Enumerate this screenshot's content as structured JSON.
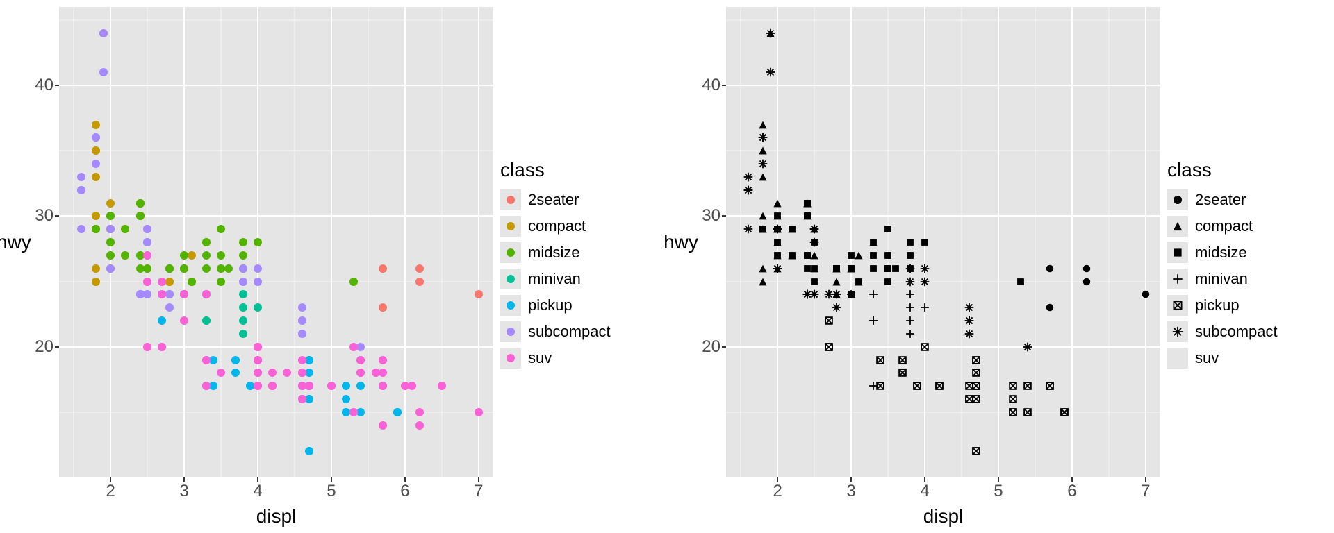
{
  "chart_data": [
    {
      "type": "scatter",
      "encoding": "color",
      "xlabel": "displ",
      "ylabel": "hwy",
      "xlim": [
        1.3,
        7.2
      ],
      "ylim": [
        10,
        46
      ],
      "x_ticks": [
        2,
        3,
        4,
        5,
        6,
        7
      ],
      "y_ticks": [
        20,
        30,
        40
      ],
      "legend_title": "class",
      "classes": [
        "2seater",
        "compact",
        "midsize",
        "minivan",
        "pickup",
        "subcompact",
        "suv"
      ],
      "colors": {
        "2seater": "#F8766D",
        "compact": "#C49A00",
        "midsize": "#53B400",
        "minivan": "#00C094",
        "pickup": "#00B6EB",
        "subcompact": "#A58AFF",
        "suv": "#FB61D7"
      },
      "series": [
        {
          "name": "2seater",
          "points": [
            [
              5.7,
              26
            ],
            [
              5.7,
              23
            ],
            [
              6.2,
              26
            ],
            [
              6.2,
              25
            ],
            [
              7.0,
              24
            ]
          ]
        },
        {
          "name": "compact",
          "points": [
            [
              1.8,
              29
            ],
            [
              1.8,
              29
            ],
            [
              2.0,
              31
            ],
            [
              2.0,
              30
            ],
            [
              2.8,
              26
            ],
            [
              2.8,
              26
            ],
            [
              3.1,
              27
            ],
            [
              1.8,
              26
            ],
            [
              1.8,
              25
            ],
            [
              2.0,
              28
            ],
            [
              2.0,
              27
            ],
            [
              2.8,
              25
            ],
            [
              2.8,
              25
            ],
            [
              3.1,
              25
            ],
            [
              3.1,
              25
            ],
            [
              2.4,
              31
            ],
            [
              2.4,
              31
            ],
            [
              2.5,
              26
            ],
            [
              2.5,
              27
            ],
            [
              2.2,
              29
            ],
            [
              2.2,
              27
            ],
            [
              2.4,
              31
            ],
            [
              2.4,
              31
            ],
            [
              3.0,
              26
            ],
            [
              2.2,
              27
            ],
            [
              2.2,
              29
            ],
            [
              2.4,
              31
            ],
            [
              2.4,
              30
            ],
            [
              3.0,
              26
            ],
            [
              3.3,
              28
            ],
            [
              1.8,
              30
            ],
            [
              1.8,
              33
            ],
            [
              1.8,
              35
            ],
            [
              1.8,
              37
            ],
            [
              1.8,
              35
            ],
            [
              2.0,
              29
            ],
            [
              2.0,
              26
            ],
            [
              2.0,
              29
            ],
            [
              2.0,
              29
            ],
            [
              2.8,
              24
            ],
            [
              1.9,
              44
            ],
            [
              2.0,
              29
            ],
            [
              2.0,
              29
            ],
            [
              2.5,
              29
            ],
            [
              2.5,
              29
            ],
            [
              1.8,
              29
            ],
            [
              1.8,
              29
            ]
          ]
        },
        {
          "name": "midsize",
          "points": [
            [
              2.8,
              26
            ],
            [
              3.1,
              25
            ],
            [
              2.4,
              27
            ],
            [
              3.5,
              29
            ],
            [
              3.6,
              26
            ],
            [
              2.4,
              26
            ],
            [
              2.4,
              27
            ],
            [
              3.3,
              26
            ],
            [
              2.5,
              25
            ],
            [
              3.5,
              25
            ],
            [
              3.0,
              24
            ],
            [
              3.0,
              24
            ],
            [
              3.5,
              27
            ],
            [
              3.3,
              27
            ],
            [
              4.0,
              28
            ],
            [
              3.8,
              28
            ],
            [
              3.8,
              27
            ],
            [
              3.8,
              26
            ],
            [
              5.3,
              25
            ],
            [
              2.2,
              27
            ],
            [
              2.2,
              29
            ],
            [
              2.4,
              31
            ],
            [
              2.4,
              31
            ],
            [
              3.0,
              26
            ],
            [
              2.4,
              30
            ],
            [
              2.4,
              30
            ],
            [
              2.5,
              26
            ],
            [
              2.5,
              28
            ],
            [
              3.5,
              26
            ],
            [
              3.5,
              26
            ],
            [
              3.0,
              26
            ],
            [
              3.0,
              27
            ],
            [
              3.3,
              28
            ],
            [
              1.8,
              29
            ],
            [
              2.0,
              27
            ],
            [
              2.0,
              30
            ],
            [
              2.8,
              26
            ],
            [
              2.8,
              26
            ],
            [
              1.8,
              29
            ],
            [
              1.8,
              29
            ],
            [
              2.0,
              28
            ],
            [
              2.0,
              29
            ]
          ]
        },
        {
          "name": "minivan",
          "points": [
            [
              2.4,
              24
            ],
            [
              3.0,
              24
            ],
            [
              3.3,
              22
            ],
            [
              3.3,
              22
            ],
            [
              3.3,
              24
            ],
            [
              3.8,
              24
            ],
            [
              3.8,
              22
            ],
            [
              3.8,
              21
            ],
            [
              3.8,
              23
            ],
            [
              4.0,
              23
            ],
            [
              3.3,
              17
            ]
          ]
        },
        {
          "name": "pickup",
          "points": [
            [
              3.7,
              19
            ],
            [
              3.7,
              18
            ],
            [
              3.9,
              17
            ],
            [
              3.9,
              17
            ],
            [
              4.7,
              19
            ],
            [
              4.7,
              19
            ],
            [
              4.7,
              12
            ],
            [
              5.2,
              17
            ],
            [
              5.2,
              15
            ],
            [
              5.7,
              17
            ],
            [
              5.9,
              15
            ],
            [
              4.7,
              16
            ],
            [
              4.7,
              12
            ],
            [
              4.7,
              17
            ],
            [
              4.7,
              17
            ],
            [
              4.7,
              16
            ],
            [
              4.7,
              18
            ],
            [
              5.2,
              15
            ],
            [
              5.2,
              16
            ],
            [
              5.7,
              17
            ],
            [
              5.9,
              15
            ],
            [
              4.2,
              17
            ],
            [
              4.2,
              17
            ],
            [
              4.6,
              16
            ],
            [
              4.6,
              16
            ],
            [
              4.6,
              17
            ],
            [
              5.4,
              17
            ],
            [
              5.4,
              15
            ],
            [
              2.7,
              20
            ],
            [
              2.7,
              20
            ],
            [
              2.7,
              22
            ],
            [
              3.4,
              17
            ],
            [
              3.4,
              19
            ],
            [
              4.0,
              20
            ]
          ]
        },
        {
          "name": "subcompact",
          "points": [
            [
              3.8,
              26
            ],
            [
              3.8,
              25
            ],
            [
              4.0,
              26
            ],
            [
              4.0,
              25
            ],
            [
              4.6,
              21
            ],
            [
              4.6,
              22
            ],
            [
              4.6,
              23
            ],
            [
              4.6,
              22
            ],
            [
              5.4,
              20
            ],
            [
              1.6,
              33
            ],
            [
              1.6,
              32
            ],
            [
              1.6,
              32
            ],
            [
              1.6,
              29
            ],
            [
              1.6,
              32
            ],
            [
              1.8,
              34
            ],
            [
              1.8,
              36
            ],
            [
              1.8,
              36
            ],
            [
              2.0,
              29
            ],
            [
              2.4,
              24
            ],
            [
              2.4,
              24
            ],
            [
              2.4,
              24
            ],
            [
              2.4,
              24
            ],
            [
              2.5,
              24
            ],
            [
              2.5,
              24
            ],
            [
              1.9,
              44
            ],
            [
              1.9,
              41
            ],
            [
              2.0,
              29
            ],
            [
              2.0,
              26
            ],
            [
              2.5,
              28
            ],
            [
              2.5,
              29
            ],
            [
              2.5,
              29
            ],
            [
              2.8,
              23
            ],
            [
              2.8,
              24
            ],
            [
              2.0,
              26
            ],
            [
              2.7,
              24
            ]
          ]
        },
        {
          "name": "suv",
          "points": [
            [
              5.3,
              20
            ],
            [
              5.3,
              15
            ],
            [
              5.3,
              20
            ],
            [
              5.7,
              17
            ],
            [
              6.0,
              17
            ],
            [
              5.7,
              19
            ],
            [
              5.7,
              14
            ],
            [
              6.2,
              15
            ],
            [
              6.2,
              14
            ],
            [
              7.0,
              15
            ],
            [
              6.5,
              17
            ],
            [
              2.7,
              20
            ],
            [
              2.7,
              20
            ],
            [
              4.0,
              19
            ],
            [
              4.0,
              20
            ],
            [
              4.0,
              17
            ],
            [
              4.0,
              19
            ],
            [
              4.0,
              18
            ],
            [
              4.0,
              20
            ],
            [
              4.6,
              17
            ],
            [
              5.0,
              17
            ],
            [
              4.2,
              17
            ],
            [
              4.2,
              17
            ],
            [
              4.6,
              16
            ],
            [
              4.6,
              18
            ],
            [
              4.6,
              18
            ],
            [
              5.4,
              18
            ],
            [
              5.4,
              19
            ],
            [
              5.4,
              19
            ],
            [
              4.0,
              17
            ],
            [
              4.0,
              20
            ],
            [
              4.6,
              19
            ],
            [
              5.0,
              17
            ],
            [
              3.3,
              19
            ],
            [
              3.3,
              19
            ],
            [
              4.0,
              20
            ],
            [
              5.6,
              18
            ],
            [
              3.0,
              24
            ],
            [
              3.0,
              22
            ],
            [
              3.5,
              18
            ],
            [
              3.3,
              17
            ],
            [
              3.3,
              24
            ],
            [
              4.0,
              19
            ],
            [
              5.6,
              18
            ],
            [
              2.5,
              20
            ],
            [
              2.5,
              27
            ],
            [
              2.5,
              25
            ],
            [
              2.5,
              20
            ],
            [
              2.5,
              27
            ],
            [
              2.5,
              25
            ],
            [
              2.7,
              25
            ],
            [
              2.7,
              24
            ],
            [
              4.0,
              20
            ],
            [
              4.7,
              17
            ],
            [
              4.7,
              17
            ],
            [
              5.7,
              18
            ],
            [
              6.1,
              17
            ],
            [
              4.0,
              18
            ],
            [
              4.2,
              18
            ],
            [
              4.4,
              18
            ],
            [
              4.6,
              18
            ],
            [
              5.4,
              18
            ],
            [
              5.4,
              18
            ]
          ]
        }
      ]
    },
    {
      "type": "scatter",
      "encoding": "shape",
      "xlabel": "displ",
      "ylabel": "hwy",
      "xlim": [
        1.3,
        7.2
      ],
      "ylim": [
        10,
        46
      ],
      "x_ticks": [
        2,
        3,
        4,
        5,
        6,
        7
      ],
      "y_ticks": [
        20,
        30,
        40
      ],
      "legend_title": "class",
      "classes": [
        "2seater",
        "compact",
        "midsize",
        "minivan",
        "pickup",
        "subcompact",
        "suv"
      ],
      "shapes": {
        "2seater": "circle",
        "compact": "triangle",
        "midsize": "square",
        "minivan": "plus",
        "pickup": "boxx",
        "subcompact": "asterisk",
        "suv": null
      }
    }
  ]
}
